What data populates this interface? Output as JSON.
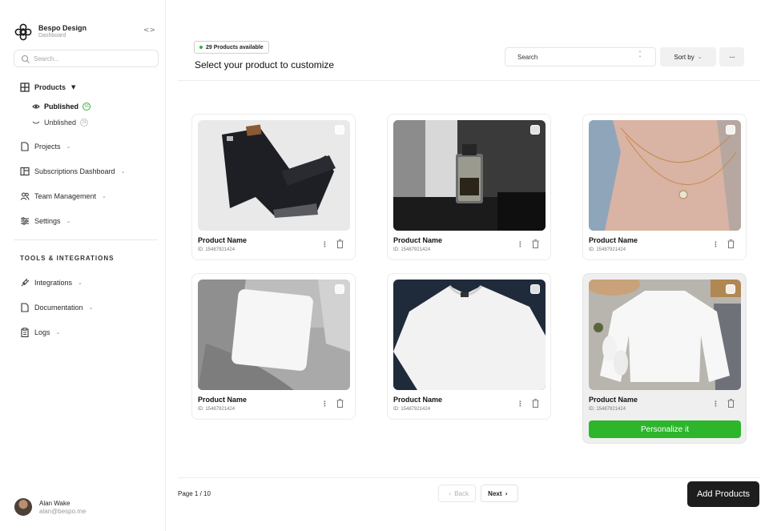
{
  "brand": {
    "name": "Bespo Design",
    "subtitle": "Dashboard",
    "collapse_icon": "<>"
  },
  "sidebar": {
    "search_placeholder": "Search...",
    "products": {
      "label": "Products",
      "sub": [
        {
          "label": "Published",
          "count": "16"
        },
        {
          "label": "Unblished",
          "count": "24"
        }
      ]
    },
    "nav": [
      {
        "label": "Projects",
        "icon": "document-icon"
      },
      {
        "label": "Subscriptions Dashboard",
        "icon": "layout-icon"
      },
      {
        "label": "Team Management",
        "icon": "users-icon"
      },
      {
        "label": "Settings",
        "icon": "sliders-icon"
      }
    ],
    "section_title": "TOOLS & INTEGRATIONS",
    "tools": [
      {
        "label": "Integrations",
        "icon": "plug-icon"
      },
      {
        "label": "Documentation",
        "icon": "document-icon"
      },
      {
        "label": "Logs",
        "icon": "clipboard-icon"
      }
    ]
  },
  "user": {
    "name": "Alan Wake",
    "email": "alan@bespo.me"
  },
  "header": {
    "badge": "29 Products available",
    "title": "Select your product to customize",
    "search_label": "Search",
    "sort_label": "Sort by",
    "more_label": "···"
  },
  "products": [
    {
      "name": "Product Name",
      "id": "ID: 15487921424",
      "image": "jeans"
    },
    {
      "name": "Product Name",
      "id": "ID: 15487921424",
      "image": "perfume"
    },
    {
      "name": "Product Name",
      "id": "ID: 15487921424",
      "image": "necklace"
    },
    {
      "name": "Product Name",
      "id": "ID: 15487921424",
      "image": "pillow"
    },
    {
      "name": "Product Name",
      "id": "ID: 15487921424",
      "image": "tshirt"
    },
    {
      "name": "Product Name",
      "id": "ID: 15487921424",
      "image": "sweater",
      "selected": true,
      "action": "Personalize it"
    }
  ],
  "footer": {
    "page_info": "Page 1 / 10",
    "back_label": "Back",
    "next_label": "Next",
    "add_label": "Add Products"
  },
  "colors": {
    "accent_green": "#2db52c",
    "primary_dark": "#1d1d1d"
  }
}
